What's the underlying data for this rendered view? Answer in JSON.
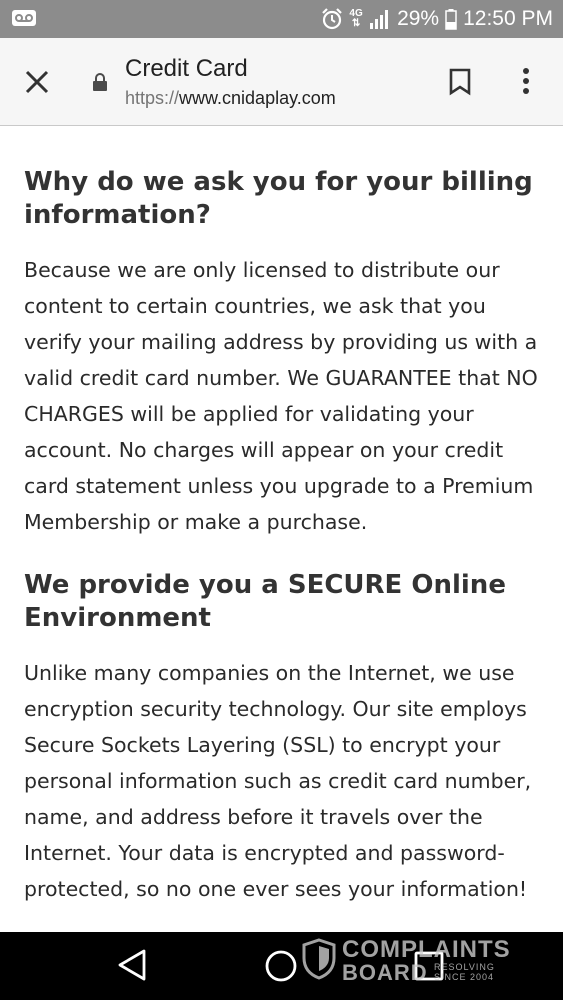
{
  "status_bar": {
    "network_label": "4G",
    "battery_text": "29%",
    "time": "12:50 PM",
    "icons": [
      "voicemail-icon",
      "alarm-icon",
      "signal-icon",
      "battery-icon"
    ]
  },
  "toolbar": {
    "title": "Credit Card",
    "url_scheme": "https://",
    "url_host": "www.cnidaplay.com",
    "icons": [
      "close-icon",
      "lock-icon",
      "bookmark-icon",
      "more-vert-icon"
    ]
  },
  "sections": [
    {
      "heading": "Why do we ask you for your billing information?",
      "body": "Because we are only licensed to distribute our content to certain countries, we ask that you verify your mailing address by providing us with a valid credit card number. We GUARANTEE that NO CHARGES will be applied for validating your account. No charges will appear on your credit card statement unless you upgrade to a Premium Membership or make a purchase."
    },
    {
      "heading": "We provide you a SECURE Online Environment",
      "body": "Unlike many companies on the Internet, we use encryption security technology. Our site employs Secure Sockets Layering (SSL) to encrypt your personal information such as credit card number, name, and address before it travels over the Internet. Your data is encrypted and password-protected, so no one ever sees your information!"
    }
  ],
  "nav_bar": {
    "icons": [
      "back-icon",
      "home-icon",
      "recents-icon"
    ]
  },
  "watermark": {
    "line1": "COMPLAINTS",
    "line2": "BOARD",
    "tagline1": "RESOLVING",
    "tagline2": "SINCE 2004"
  },
  "colors": {
    "status_bar_bg": "#8c8c8c",
    "toolbar_bg": "#f6f6f6",
    "nav_bar_bg": "#000000",
    "text": "#2a2a2a"
  }
}
